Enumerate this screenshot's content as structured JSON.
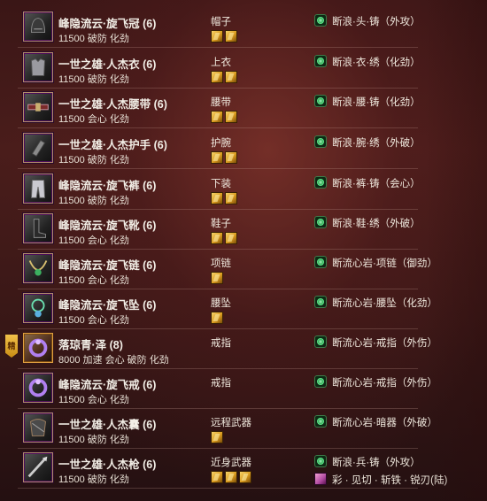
{
  "items": [
    {
      "name": "峰隐流云·旋飞冠 (6)",
      "stats": "11500 破防 化劲",
      "slot": "帽子",
      "gems": 2,
      "enchant": "断浪·头·铸（外攻）",
      "icon": "helmet-icon"
    },
    {
      "name": "一世之雄·人杰衣 (6)",
      "stats": "11500 破防 化劲",
      "slot": "上衣",
      "gems": 2,
      "enchant": "断浪·衣·绣（化劲）",
      "icon": "armor-icon"
    },
    {
      "name": "一世之雄·人杰腰带 (6)",
      "stats": "11500 会心 化劲",
      "slot": "腰带",
      "gems": 2,
      "enchant": "断浪·腰·铸（化劲）",
      "icon": "belt-icon"
    },
    {
      "name": "一世之雄·人杰护手 (6)",
      "stats": "11500 破防 化劲",
      "slot": "护腕",
      "gems": 2,
      "enchant": "断浪·腕·绣（外破）",
      "icon": "bracer-icon"
    },
    {
      "name": "峰隐流云·旋飞裤 (6)",
      "stats": "11500 破防 化劲",
      "slot": "下装",
      "gems": 2,
      "enchant": "断浪·裤·铸（会心）",
      "icon": "pants-icon"
    },
    {
      "name": "峰隐流云·旋飞靴 (6)",
      "stats": "11500 会心 化劲",
      "slot": "鞋子",
      "gems": 2,
      "enchant": "断浪·鞋·绣（外破）",
      "icon": "boots-icon"
    },
    {
      "name": "峰隐流云·旋飞链 (6)",
      "stats": "11500 会心 化劲",
      "slot": "项链",
      "gems": 1,
      "enchant": "断流心岩·项链（御劲）",
      "icon": "necklace-icon"
    },
    {
      "name": "峰隐流云·旋飞坠 (6)",
      "stats": "11500 会心 化劲",
      "slot": "腰坠",
      "gems": 1,
      "enchant": "断流心岩·腰坠（化劲）",
      "icon": "pendant-icon"
    },
    {
      "name": "落琼青·泽 (8)",
      "stats": "8000 加速 会心 破防 化劲",
      "slot": "戒指",
      "gems": 0,
      "enchant": "断流心岩·戒指（外伤）",
      "icon": "ring-icon",
      "badge": "精"
    },
    {
      "name": "峰隐流云·旋飞戒 (6)",
      "stats": "11500 会心 化劲",
      "slot": "戒指",
      "gems": 0,
      "enchant": "断流心岩·戒指（外伤）",
      "icon": "ring-icon"
    },
    {
      "name": "一世之雄·人杰囊 (6)",
      "stats": "11500 破防 化劲",
      "slot": "远程武器",
      "gems": 1,
      "enchant": "断流心岩·暗器（外破）",
      "icon": "pouch-icon"
    },
    {
      "name": "一世之雄·人杰枪 (6)",
      "stats": "11500 破防 化劲",
      "slot": "近身武器",
      "gems": 3,
      "enchant": "断浪·兵·铸（外攻）",
      "enchant2": "彩 · 见切 · 斩铁 · 锐刃(陆)",
      "icon": "spear-icon"
    }
  ],
  "colors": {
    "gem": "#e0a42a",
    "enchant": "#3cc86a",
    "border": "#b08a6a"
  }
}
